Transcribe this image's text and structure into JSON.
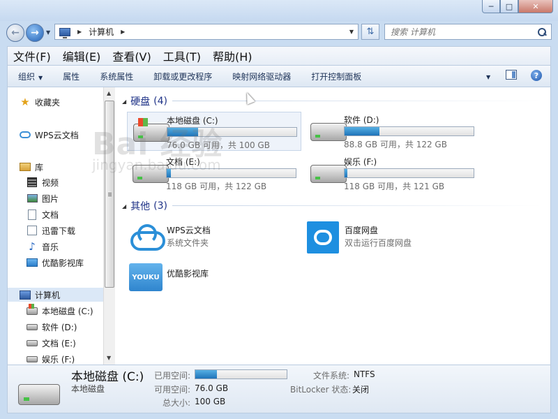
{
  "window": {
    "minimize": "─",
    "maximize": "□",
    "close": "✕"
  },
  "address": {
    "path": "计算机",
    "search_placeholder": "搜索 计算机"
  },
  "menu": [
    "文件(F)",
    "编辑(E)",
    "查看(V)",
    "工具(T)",
    "帮助(H)"
  ],
  "toolbar": {
    "organize": "组织",
    "properties": "属性",
    "system_properties": "系统属性",
    "uninstall": "卸载或更改程序",
    "map_drive": "映射网络驱动器",
    "control_panel": "打开控制面板",
    "help": "?"
  },
  "sidebar": {
    "favorites": "收藏夹",
    "wps": "WPS云文档",
    "library": "库",
    "lib_items": [
      "视频",
      "图片",
      "文档",
      "迅雷下载",
      "音乐",
      "优酷影视库"
    ],
    "computer": "计算机",
    "drives": [
      "本地磁盘 (C:)",
      "软件 (D:)",
      "文档 (E:)",
      "娱乐 (F:)"
    ]
  },
  "groups": {
    "hard_disks": {
      "title": "硬盘",
      "count": "(4)"
    },
    "others": {
      "title": "其他",
      "count": "(3)"
    }
  },
  "drives": [
    {
      "name": "本地磁盘 (C:)",
      "free_text": "76.0 GB 可用，共 100 GB",
      "used_fraction": 0.24
    },
    {
      "name": "软件 (D:)",
      "free_text": "88.8 GB 可用，共 122 GB",
      "used_fraction": 0.27
    },
    {
      "name": "文档 (E:)",
      "free_text": "118 GB 可用，共 122 GB",
      "used_fraction": 0.03
    },
    {
      "name": "娱乐 (F:)",
      "free_text": "118 GB 可用，共 121 GB",
      "used_fraction": 0.02
    }
  ],
  "others": [
    {
      "name": "WPS云文档",
      "sub": "系统文件夹"
    },
    {
      "name": "百度网盘",
      "sub": "双击运行百度网盘"
    },
    {
      "name": "优酷影视库",
      "sub": ""
    }
  ],
  "youku_logo": "YOUKU",
  "watermark": {
    "big": "Bai 经验",
    "small": "jingyan.baidu.com"
  },
  "details": {
    "title": "本地磁盘 (C:)",
    "subtitle": "本地磁盘",
    "used_label": "已用空间:",
    "used_fraction": 0.24,
    "free_label": "可用空间:",
    "free_value": "76.0 GB",
    "total_label": "总大小:",
    "total_value": "100 GB",
    "fs_label": "文件系统:",
    "fs_value": "NTFS",
    "bitlocker_label": "BitLocker 状态:",
    "bitlocker_value": "关闭"
  },
  "colors": {
    "accent": "#1e74b9",
    "group_title": "#1e3287",
    "close_button": "#c9786a"
  }
}
